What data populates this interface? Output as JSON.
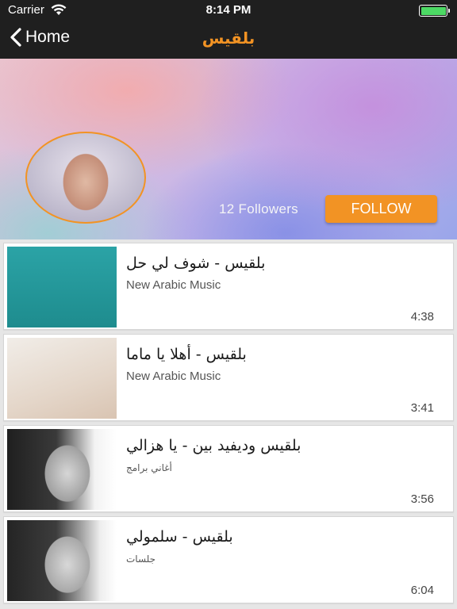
{
  "status_bar": {
    "carrier": "Carrier",
    "time": "8:14 PM",
    "battery_level": 1.0,
    "wifi_icon": "wifi-icon",
    "battery_icon": "battery-icon"
  },
  "nav": {
    "back_label": "Home",
    "back_icon": "chevron-left-icon",
    "title": "بلقيس"
  },
  "profile": {
    "followers_text": "12 Followers",
    "follow_label": "FOLLOW",
    "accent_color": "#f29324"
  },
  "songs": [
    {
      "title": "بلقيس - شوف لي حل",
      "subtitle": "New Arabic Music",
      "duration": "4:38"
    },
    {
      "title": "بلقيس - أهلا يا ماما",
      "subtitle": "New Arabic Music",
      "duration": "3:41"
    },
    {
      "title": "بلقيس وديفيد بين - يا هزالي",
      "subtitle": "أغاني برامج",
      "duration": "3:56"
    },
    {
      "title": "بلقيس - سلمولي",
      "subtitle": "جلسات",
      "duration": "6:04"
    }
  ]
}
